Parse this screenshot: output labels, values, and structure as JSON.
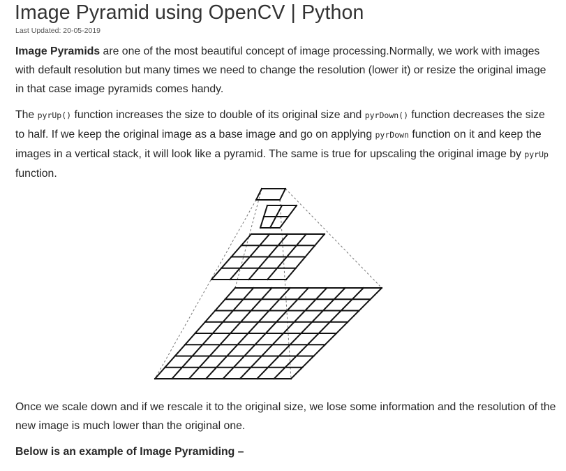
{
  "header": {
    "title": "Image Pyramid using OpenCV | Python",
    "last_updated": "Last Updated: 20-05-2019"
  },
  "intro": {
    "bold_term": "Image Pyramids",
    "text": " are one of the most beautiful concept of image processing.Normally, we work with images with default resolution but many times we need to change the resolution (lower it) or resize the original image in that case image pyramids comes handy."
  },
  "functions": {
    "t1": "The ",
    "code1": "pyrUp()",
    "t2": " function increases the size to double of its original size and ",
    "code2": "pyrDown()",
    "t3": " function decreases the size to half. If we keep the original image as a base image and go on applying ",
    "code3": "pyrDown",
    "t4": " function on it and keep the images in a vertical stack, it will look like a pyramid. The same is true for upscaling the original image by ",
    "code4": "pyrUp",
    "t5": " function."
  },
  "figure": {
    "description_icon": "image-pyramid-diagram-icon",
    "levels_grid": [
      1,
      2,
      4,
      8
    ]
  },
  "scaling_note": {
    "text": "Once we scale down and if we rescale it to the original size, we lose some information and the resolution of the new image is much lower than the original one."
  },
  "example_heading": {
    "text": "Below is an example of Image Pyramiding –"
  }
}
